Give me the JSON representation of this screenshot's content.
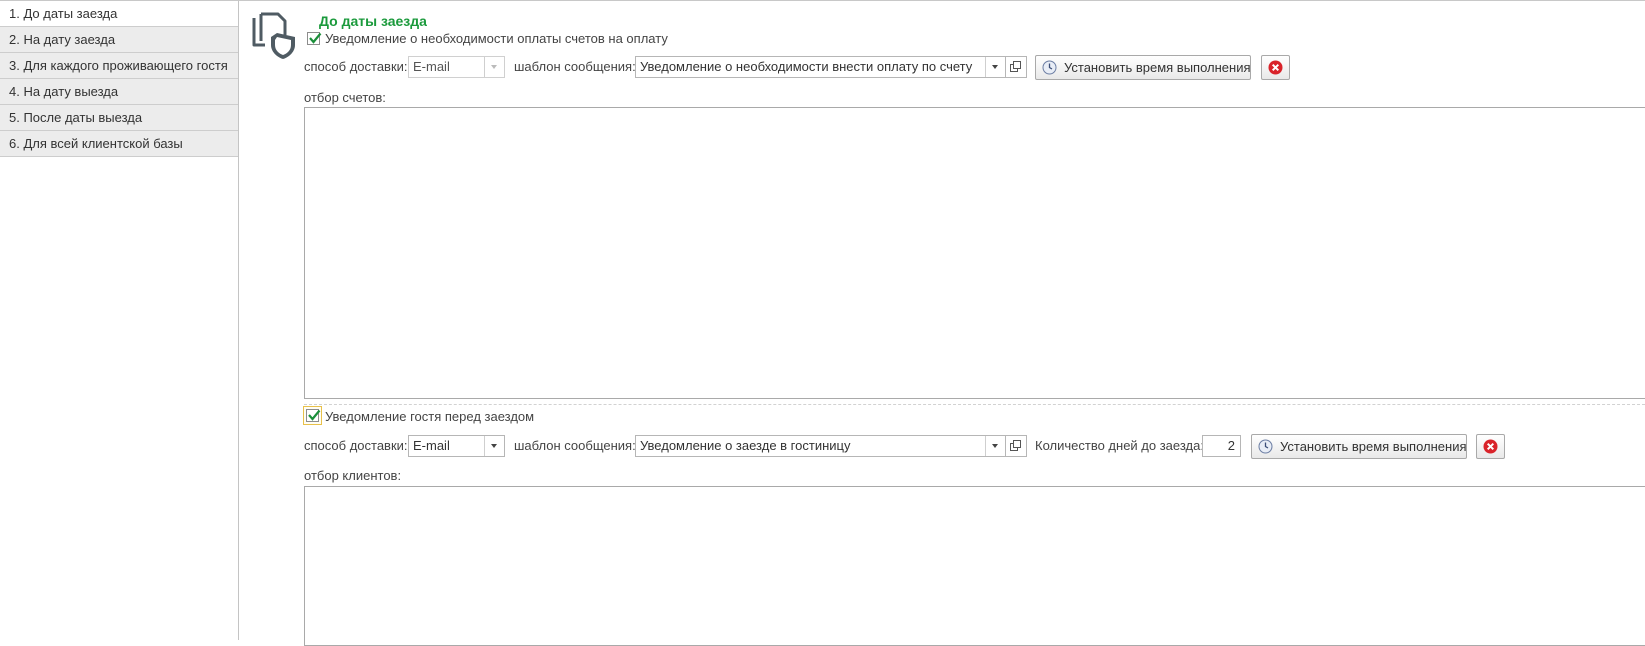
{
  "nav": {
    "items": [
      {
        "label": "1. До даты заезда"
      },
      {
        "label": "2. На дату заезда"
      },
      {
        "label": "3. Для каждого проживающего гостя"
      },
      {
        "label": "4. На дату выезда"
      },
      {
        "label": "5. После даты выезда"
      },
      {
        "label": "6. Для всей клиентской базы"
      }
    ]
  },
  "page": {
    "title": "До даты заезда",
    "title_color": "#1b9a3c"
  },
  "section1": {
    "checkbox_label": "Уведомление о необходимости оплаты счетов на оплату",
    "checked": true,
    "delivery_label": "способ доставки:",
    "delivery_value": "E-mail",
    "template_label": "шаблон сообщения:",
    "template_value": "Уведомление о необходимости внести оплату по счету",
    "schedule_button": "Установить время выполнения",
    "filter_label": "отбор счетов:"
  },
  "section2": {
    "checkbox_label": "Уведомление гостя перед заездом",
    "checked": true,
    "delivery_label": "способ доставки:",
    "delivery_value": "E-mail",
    "template_label": "шаблон сообщения:",
    "template_value": "Уведомление о заезде в гостиницу",
    "days_label": "Количество дней до заезда:",
    "days_value": "2",
    "schedule_button": "Установить время выполнения",
    "filter_label": "отбор клиентов:"
  },
  "icons": {
    "header": "documents-shield-icon",
    "clock": "clock-icon",
    "delete": "delete-icon",
    "open": "open-window-icon",
    "check": "checkmark-icon",
    "dropdown": "chevron-down-icon"
  },
  "colors": {
    "check": "#1b8f3a",
    "delete": "#d9232a",
    "focus": "#e8c14a"
  }
}
